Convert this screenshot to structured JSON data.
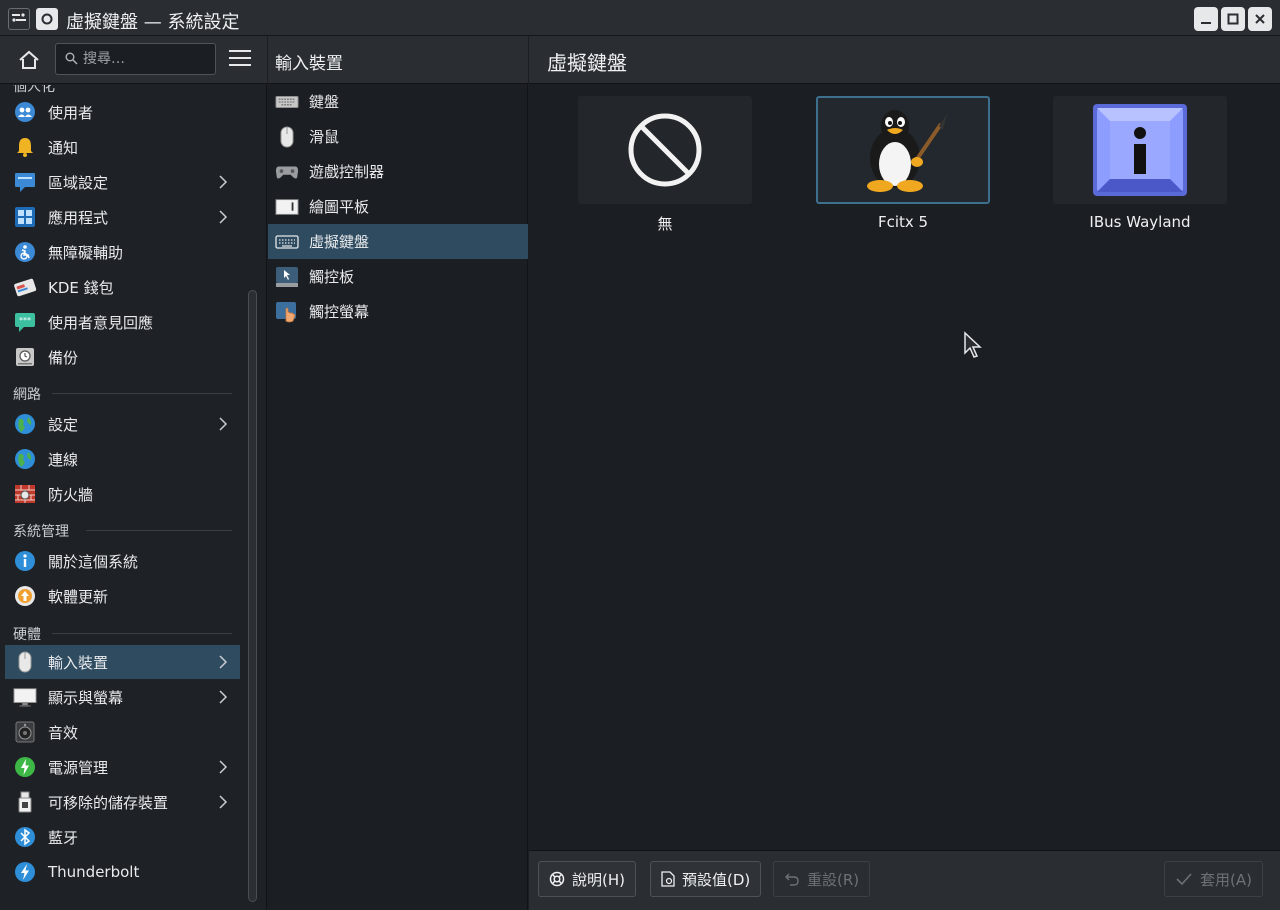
{
  "window": {
    "title": "虛擬鍵盤 — 系統設定"
  },
  "sidebar": {
    "search_placeholder": "搜尋…",
    "partial_category": "個人化",
    "personal": [
      {
        "label": "使用者",
        "icon": "users-icon",
        "arrow": false
      },
      {
        "label": "通知",
        "icon": "bell-icon",
        "arrow": false
      },
      {
        "label": "區域設定",
        "icon": "region-icon",
        "arrow": true
      },
      {
        "label": "應用程式",
        "icon": "apps-icon",
        "arrow": true
      },
      {
        "label": "無障礙輔助",
        "icon": "accessibility-icon",
        "arrow": false
      },
      {
        "label": "KDE 錢包",
        "icon": "wallet-icon",
        "arrow": false
      },
      {
        "label": "使用者意見回應",
        "icon": "feedback-icon",
        "arrow": false
      },
      {
        "label": "備份",
        "icon": "backup-icon",
        "arrow": false
      }
    ],
    "network_category": "網路",
    "network": [
      {
        "label": "設定",
        "icon": "globe-icon",
        "arrow": true
      },
      {
        "label": "連線",
        "icon": "globe-icon",
        "arrow": false
      },
      {
        "label": "防火牆",
        "icon": "firewall-icon",
        "arrow": false
      }
    ],
    "system_category": "系統管理",
    "system": [
      {
        "label": "關於這個系統",
        "icon": "info-icon",
        "arrow": false
      },
      {
        "label": "軟體更新",
        "icon": "update-icon",
        "arrow": false
      }
    ],
    "hardware_category": "硬體",
    "hardware": [
      {
        "label": "輸入裝置",
        "icon": "mouse-icon",
        "arrow": true,
        "selected": true
      },
      {
        "label": "顯示與螢幕",
        "icon": "display-icon",
        "arrow": true
      },
      {
        "label": "音效",
        "icon": "speaker-icon",
        "arrow": false
      },
      {
        "label": "電源管理",
        "icon": "power-icon",
        "arrow": true
      },
      {
        "label": "可移除的儲存裝置",
        "icon": "usb-icon",
        "arrow": true
      },
      {
        "label": "藍牙",
        "icon": "bluetooth-icon",
        "arrow": false
      },
      {
        "label": "Thunderbolt",
        "icon": "thunderbolt-icon",
        "arrow": false
      }
    ]
  },
  "subpanel": {
    "title": "輸入裝置",
    "items": [
      {
        "label": "鍵盤",
        "icon": "keyboard-icon"
      },
      {
        "label": "滑鼠",
        "icon": "mouse-icon"
      },
      {
        "label": "遊戲控制器",
        "icon": "gamepad-icon"
      },
      {
        "label": "繪圖平板",
        "icon": "tablet-icon"
      },
      {
        "label": "虛擬鍵盤",
        "icon": "virtual-keyboard-icon",
        "selected": true
      },
      {
        "label": "觸控板",
        "icon": "touchpad-icon"
      },
      {
        "label": "觸控螢幕",
        "icon": "touchscreen-icon"
      }
    ]
  },
  "main": {
    "title": "虛擬鍵盤",
    "options": [
      {
        "label": "無",
        "icon": "none-icon",
        "selected": false
      },
      {
        "label": "Fcitx 5",
        "icon": "tux-icon",
        "selected": true
      },
      {
        "label": "IBus Wayland",
        "icon": "ibus-info-icon",
        "selected": false
      }
    ]
  },
  "footer": {
    "help": "說明(H)",
    "defaults": "預設值(D)",
    "reset": "重設(R)",
    "apply": "套用(A)"
  },
  "colors": {
    "selection": "#2e4b60",
    "tile_selected_border": "#3d6f8e",
    "panel_header": "#2a2e32",
    "background": "#1b1e22"
  }
}
